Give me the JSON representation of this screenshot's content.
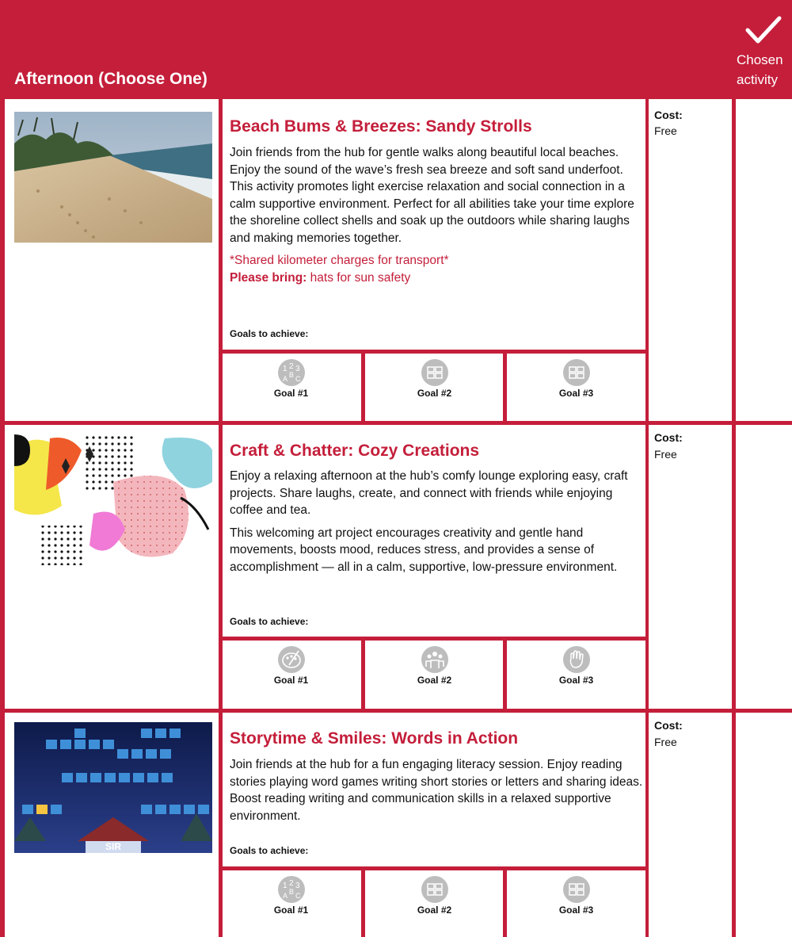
{
  "header": {
    "title": "Afternoon (Choose One)",
    "chosen_label_line1": "Chosen",
    "chosen_label_line2": "activity"
  },
  "colors": {
    "brand_red": "#c41e3a",
    "goal_icon_gray": "#bdbdbd"
  },
  "cost_label": "Cost:",
  "goals_label": "Goals to achieve:",
  "activities": [
    {
      "title": "Beach Bums & Breezes: Sandy Strolls",
      "description": [
        "Join friends from the hub for gentle walks along beautiful local beaches. Enjoy the sound of the wave’s fresh sea breeze and soft sand underfoot. This activity promotes light exercise relaxation and social connection in a calm supportive environment. Perfect for all abilities take your time explore the shoreline collect shells and soak up the outdoors while sharing laughs and making memories together."
      ],
      "note": "*Shared kilometer charges for transport*",
      "bring_label": "Please bring:",
      "bring_value": " hats for sun safety",
      "cost": "Free",
      "image": "beach-photo",
      "goals": [
        {
          "label": "Goal #1",
          "icon": "numbers-letters-icon"
        },
        {
          "label": "Goal #2",
          "icon": "hands-together-icon"
        },
        {
          "label": "Goal #3",
          "icon": "hands-together-icon"
        }
      ]
    },
    {
      "title": "Craft & Chatter: Cozy Creations",
      "description": [
        "Enjoy a relaxing afternoon at the hub’s comfy lounge exploring easy, craft projects. Share laughs, create, and connect with friends while enjoying coffee and tea.",
        "This welcoming art project encourages creativity and gentle hand movements, boosts mood, reduces stress, and provides a sense of accomplishment — all in a calm, supportive, low-pressure environment."
      ],
      "cost": "Free",
      "image": "craft-pattern-image",
      "goals": [
        {
          "label": "Goal #1",
          "icon": "paint-palette-icon"
        },
        {
          "label": "Goal #2",
          "icon": "group-people-icon"
        },
        {
          "label": "Goal #3",
          "icon": "hand-icon"
        }
      ]
    },
    {
      "title": "Storytime & Smiles: Words in Action",
      "description": [
        "Join friends at the hub for a fun engaging literacy session. Enjoy reading stories playing word games writing short stories or letters and sharing ideas. Boost reading writing and communication skills in a relaxed supportive environment."
      ],
      "cost": "Free",
      "image": "word-game-image",
      "word_game_center": "SIR",
      "goals": [
        {
          "label": "Goal #1",
          "icon": "numbers-letters-icon"
        },
        {
          "label": "Goal #2",
          "icon": "hands-together-icon"
        },
        {
          "label": "Goal #3",
          "icon": "hands-together-icon"
        }
      ]
    }
  ]
}
